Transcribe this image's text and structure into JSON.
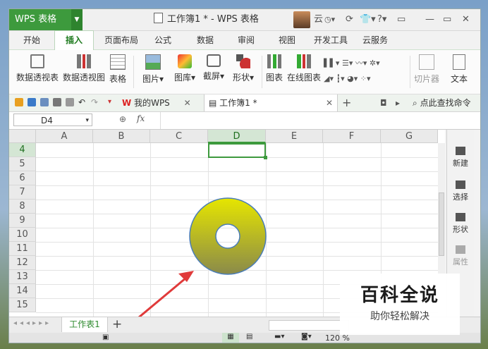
{
  "app": {
    "button_label": "WPS 表格",
    "window_title": "工作簿1 * - WPS 表格",
    "user_name": "云"
  },
  "titlebar_buttons": {
    "minimize": "—",
    "restore": "▭",
    "close": "✕"
  },
  "menu": [
    "开始",
    "插入",
    "页面布局",
    "公式",
    "数据",
    "审阅",
    "视图",
    "开发工具",
    "云服务"
  ],
  "menu_active_index": 1,
  "ribbon": {
    "pivot_table": "数据透视表",
    "pivot_chart": "数据透视图",
    "table": "表格",
    "picture": "图片",
    "gallery": "图库",
    "screenshot": "截屏",
    "shapes": "形状",
    "chart": "图表",
    "online_chart": "在线图表",
    "slicer": "切片器",
    "text": "文本"
  },
  "tabs": {
    "mywps": "我的WPS",
    "workbook": "工作簿1 *",
    "search": "点此查找命令",
    "close": "✕",
    "add": "+"
  },
  "formula_bar": {
    "cell_ref": "D4",
    "fx": "fx"
  },
  "columns": [
    "A",
    "B",
    "C",
    "D",
    "E",
    "F",
    "G"
  ],
  "selected_column": "D",
  "rows": [
    "4",
    "5",
    "6",
    "7",
    "8",
    "9",
    "10",
    "11",
    "12",
    "13",
    "14",
    "15"
  ],
  "selected_row": "4",
  "side_panel": {
    "new": "新建",
    "select": "选择",
    "shape": "形状",
    "property": "属性"
  },
  "sheet": {
    "tab_name": "工作表1",
    "add": "+"
  },
  "status": {
    "zoom": "120 %"
  },
  "shape": {
    "type": "donut",
    "fill_top": "#e6e600",
    "fill_bottom": "#8a8a4a",
    "stroke": "#4a7db8"
  },
  "arrow_color": "#e03a3a",
  "watermark": {
    "title": "百科全说",
    "subtitle": "助你轻松解决"
  }
}
